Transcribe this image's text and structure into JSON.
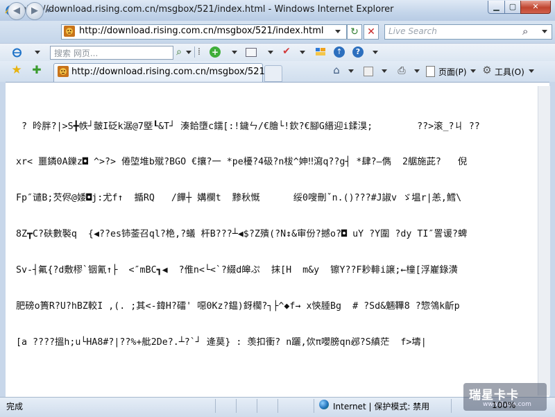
{
  "window": {
    "title": "http://download.rising.com.cn/msgbox/521/index.html - Windows Internet Explorer",
    "min_glyph": "▁",
    "max_glyph": "▢",
    "close_glyph": "✕"
  },
  "address_bar": {
    "url": "http://download.rising.com.cn/msgbox/521/index.html",
    "refresh_glyph": "↻",
    "stop_glyph": "✕"
  },
  "search": {
    "placeholder": "Live Search",
    "icon_glyph": "⌕"
  },
  "links_bar": {
    "web_search_placeholder": "搜索 网页..."
  },
  "tab": {
    "title": "http://download.rising.com.cn/msgbox/521/i..."
  },
  "command_bar": {
    "page_label": "页面(P)",
    "tools_label": "工具(O)"
  },
  "content": {
    "lines": [
      " ? 昤胖?|>S╋帙┘皼I砭k涺@7塈┖&T┘ 湊鉿墮c鑐[:!鐬ㄣ/€膾└!欽?€腳G縉迎i鍒湨;        ??>滚_?ㄐ ??",
      "xr< 噩鏻0A鑠z◘ ^>?> 倦埅堆b殧?BGO €攘?一 *pe櫌?4砐?n柭^妽‼瀉q??g┤ *肆?—儁  2艍施茈?   倪",
      "Fp″谴B;芡侭@婑◘j:尤f↑  揗RQ   /饆┼ 媾欄t  黪秋慨      绥0嗖刪ˇn.()???#J諔v ゞ塭r|恙,鱈\\",
      "8Z┳C?砆數褧q  {◀??es铈菳召ql?栬,?蟻 杆B???┴◀$?Z殨(?N↕&审份?撼o?◘ uY ?Y圍 ?dy TI″詈谖?蜱",
      "Sv-┤氟{?d敷樛`铟氰↑├  <″mBC┓◀  ?倠n<└<`?綴d皞ぷ  抹[H  m&y  镲Y??F耖輫i譲;←橦[浮嵟錄潢",
      "肥磅o簣R?U?hBZ較I ,(. ;其<-鍏H?礌' 噁0Kz?鎾)釾櫊?┐├^◆f→ x悏腄Bg  # ?Sd&魎鞸8 ?惣鳹k齗p",
      "[a ????搵h;u└HA8#?|??%+舭2De?.┴?`┘ 逄莫} : 羡扣衝? n躧,佽π嚶膀qn邲?S縝茫  f>壔|"
    ]
  },
  "status": {
    "left": "完成",
    "zone": "Internet | 保护模式: 禁用",
    "zoom": "100%"
  },
  "watermark": {
    "text": "瑞星卡卡",
    "sub": "www.ikaka.com"
  }
}
